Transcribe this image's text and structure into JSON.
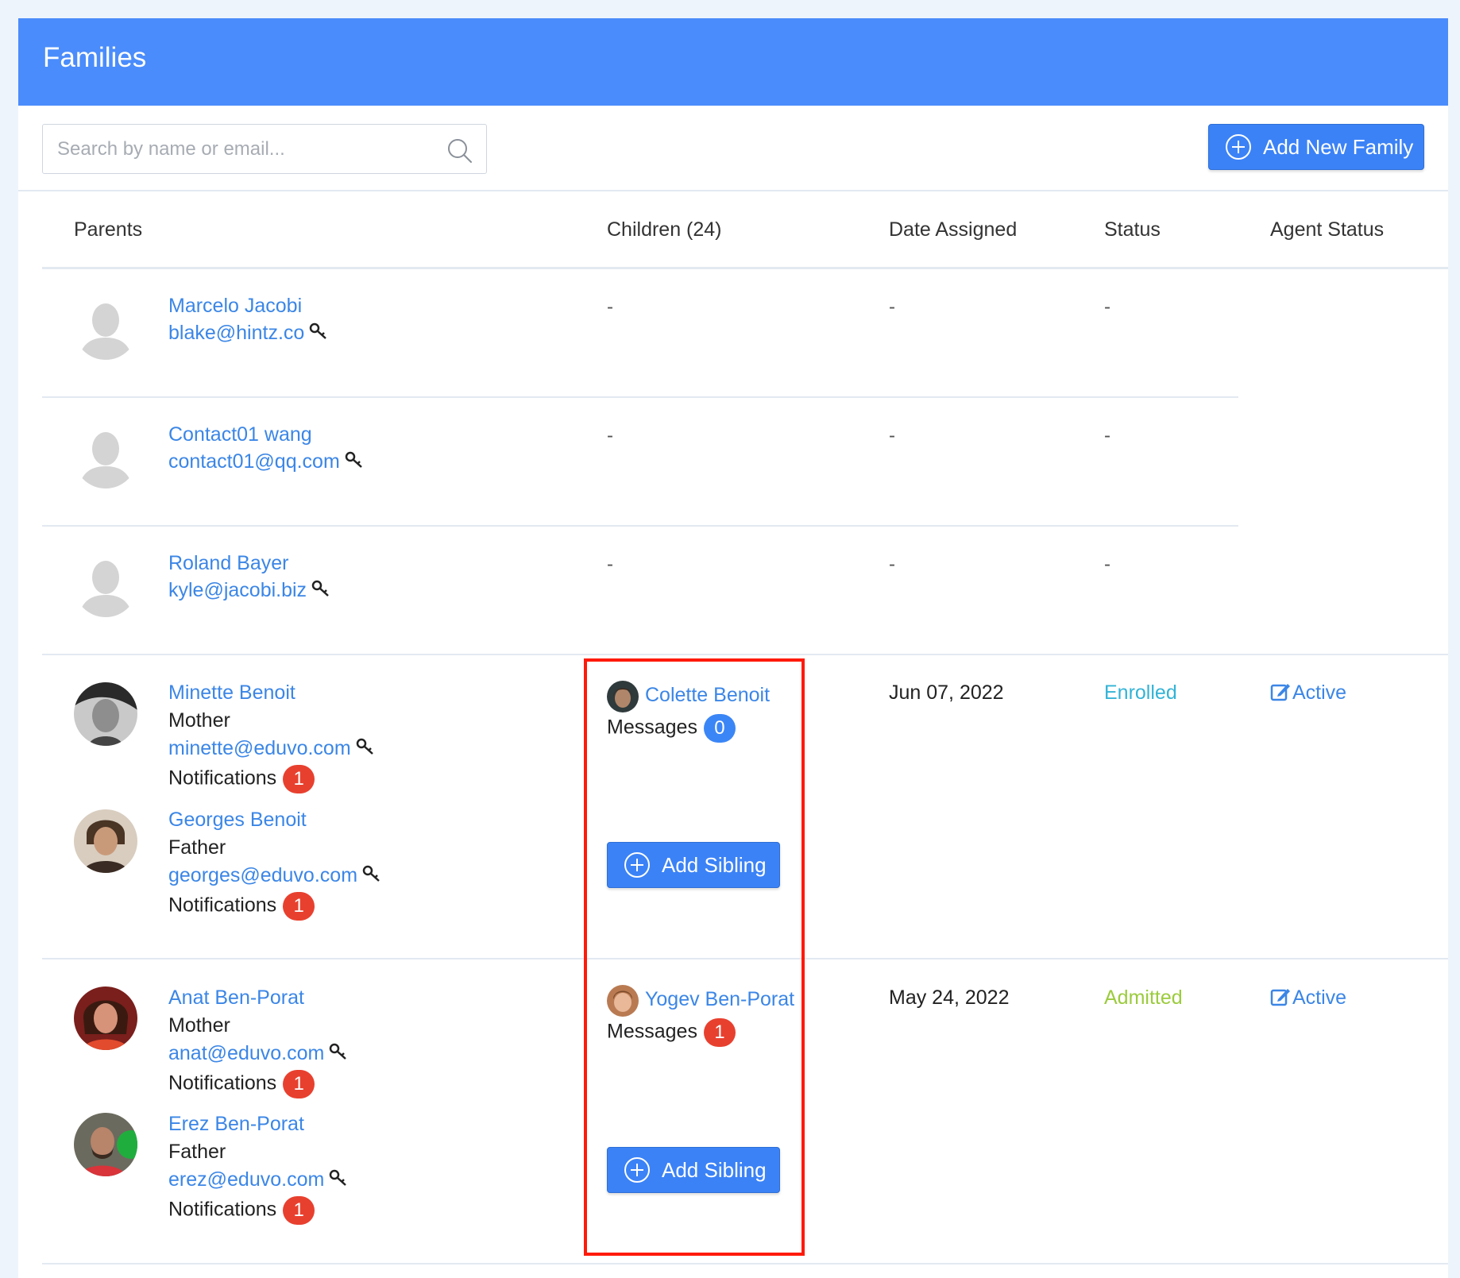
{
  "header": {
    "title": "Families"
  },
  "search": {
    "placeholder": "Search by name or email..."
  },
  "toolbar": {
    "add_family_label": "Add New Family"
  },
  "table": {
    "columns": [
      "Parents",
      "Children (24)",
      "Date Assigned",
      "Status",
      "Agent Status"
    ]
  },
  "families": [
    {
      "parent": {
        "name": "Marcelo Jacobi",
        "email": "blake@hintz.co"
      },
      "children": "-",
      "date": "-",
      "status": "-"
    },
    {
      "parent": {
        "name": "Contact01 wang",
        "email": "contact01@qq.com"
      },
      "children": "-",
      "date": "-",
      "status": "-"
    },
    {
      "parent": {
        "name": "Roland Bayer",
        "email": "kyle@jacobi.biz"
      },
      "children": "-",
      "date": "-",
      "status": "-"
    }
  ],
  "family_benoit": {
    "parents": [
      {
        "name": "Minette Benoit",
        "role": "Mother",
        "email": "minette@eduvo.com",
        "notifications_label": "Notifications",
        "notifications": "1"
      },
      {
        "name": "Georges Benoit",
        "role": "Father",
        "email": "georges@eduvo.com",
        "notifications_label": "Notifications",
        "notifications": "1"
      }
    ],
    "child": {
      "name": "Colette Benoit",
      "messages_label": "Messages",
      "messages": "0"
    },
    "add_sibling_label": "Add Sibling",
    "date": "Jun 07, 2022",
    "status": "Enrolled",
    "agent_status": "Active"
  },
  "family_benporat": {
    "parents": [
      {
        "name": "Anat Ben-Porat",
        "role": "Mother",
        "email": "anat@eduvo.com",
        "notifications_label": "Notifications",
        "notifications": "1"
      },
      {
        "name": "Erez Ben-Porat",
        "role": "Father",
        "email": "erez@eduvo.com",
        "notifications_label": "Notifications",
        "notifications": "1"
      }
    ],
    "child": {
      "name": "Yogev Ben-Porat",
      "messages_label": "Messages",
      "messages": "1"
    },
    "add_sibling_label": "Add Sibling",
    "date": "May 24, 2022",
    "status": "Admitted",
    "agent_status": "Active"
  },
  "colors": {
    "header": "#4a8cfb",
    "link": "#3b86e6",
    "button": "#3b82f6",
    "badge_red": "#e8402f",
    "badge_blue": "#3b86f6",
    "enrolled": "#33b3d6",
    "admitted": "#9bcb3c",
    "highlight": "#ff1a0a"
  },
  "icons": [
    "search-icon",
    "plus-circle-icon",
    "key-icon",
    "edit-icon",
    "default-avatar-icon"
  ]
}
